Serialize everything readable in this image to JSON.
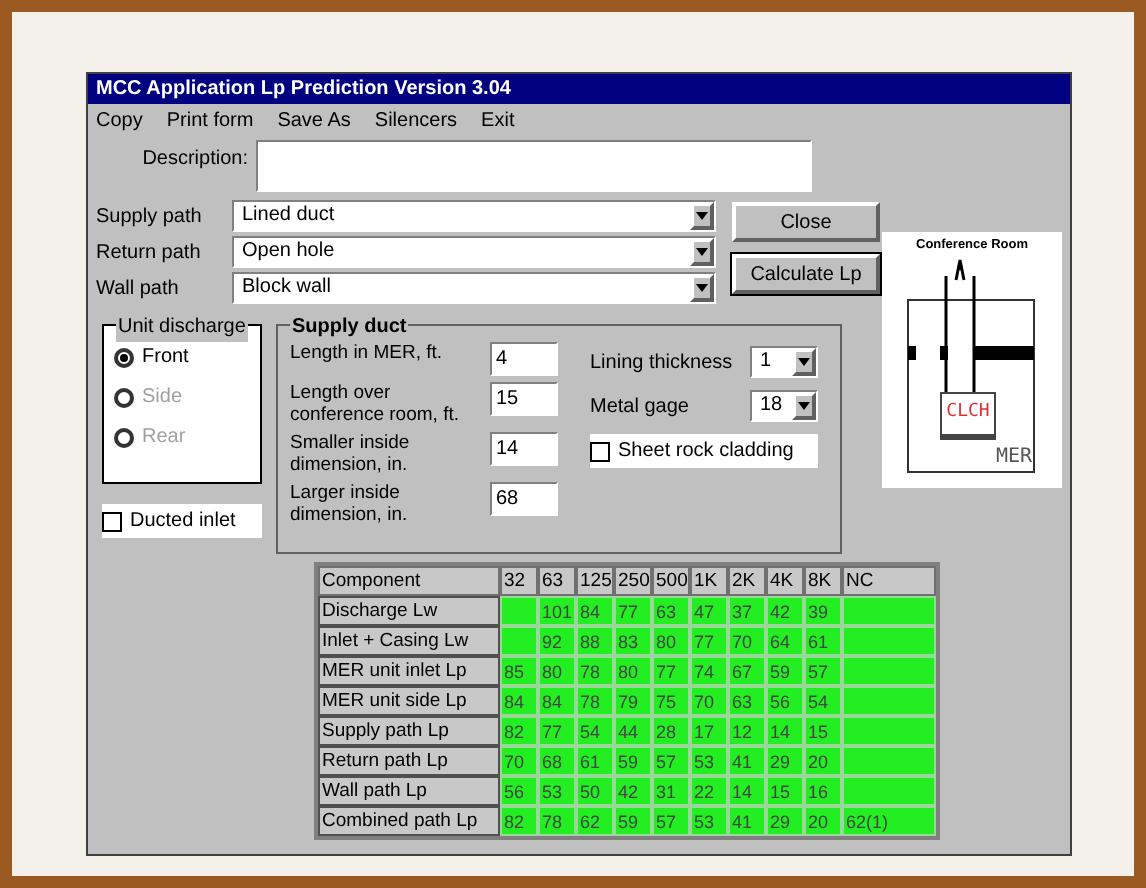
{
  "window": {
    "title": "MCC Application Lp Prediction Version 3.04"
  },
  "menu": [
    {
      "label": "Copy"
    },
    {
      "label": "Print form"
    },
    {
      "label": "Save As"
    },
    {
      "label": "Silencers"
    },
    {
      "label": "Exit"
    }
  ],
  "description": {
    "label": "Description:"
  },
  "paths": [
    {
      "label": "Supply path",
      "value": "Lined duct"
    },
    {
      "label": "Return path",
      "value": "Open hole"
    },
    {
      "label": "Wall path",
      "value": "Block wall"
    }
  ],
  "buttons": [
    {
      "label": "Close",
      "default": false
    },
    {
      "label": "Calculate Lp",
      "default": true
    }
  ],
  "unit_discharge": {
    "title": "Unit discharge",
    "options": [
      {
        "label": "Front",
        "selected": true,
        "disabled": false
      },
      {
        "label": "Side",
        "selected": false,
        "disabled": true
      },
      {
        "label": "Rear",
        "selected": false,
        "disabled": true
      }
    ]
  },
  "ducted_inlet": {
    "label": "Ducted inlet",
    "checked": false
  },
  "supply_duct": {
    "title": "Supply duct",
    "fields": [
      {
        "label": "Length in MER, ft.",
        "value": "4"
      },
      {
        "label": "Length over conference room, ft.",
        "value": "15"
      },
      {
        "label": "Smaller inside dimension, in.",
        "value": "14"
      },
      {
        "label": "Larger inside dimension, in.",
        "value": "68"
      }
    ],
    "lining_thickness": {
      "label": "Lining thickness",
      "value": "1"
    },
    "metal_gage": {
      "label": "Metal gage",
      "value": "18"
    },
    "sheet_rock": {
      "label": "Sheet rock cladding",
      "checked": false
    }
  },
  "diagram": {
    "title": "Conference Room",
    "unit_label": "CLCH",
    "room_label": "MER"
  },
  "table": {
    "columns": [
      "Component",
      "32",
      "63",
      "125",
      "250",
      "500",
      "1K",
      "2K",
      "4K",
      "8K",
      "NC"
    ],
    "rows": [
      [
        "Discharge Lw",
        null,
        "101",
        "84",
        "77",
        "63",
        "47",
        "37",
        "42",
        "39",
        null
      ],
      [
        "Inlet + Casing Lw",
        null,
        "92",
        "88",
        "83",
        "80",
        "77",
        "70",
        "64",
        "61",
        null
      ],
      [
        "MER unit inlet Lp",
        "85",
        "80",
        "78",
        "80",
        "77",
        "74",
        "67",
        "59",
        "57",
        null
      ],
      [
        "MER unit side Lp",
        "84",
        "84",
        "78",
        "79",
        "75",
        "70",
        "63",
        "56",
        "54",
        null
      ],
      [
        "Supply path Lp",
        "82",
        "77",
        "54",
        "44",
        "28",
        "17",
        "12",
        "14",
        "15",
        null
      ],
      [
        "Return path Lp",
        "70",
        "68",
        "61",
        "59",
        "57",
        "53",
        "41",
        "29",
        "20",
        null
      ],
      [
        "Wall path Lp",
        "56",
        "53",
        "50",
        "42",
        "31",
        "22",
        "14",
        "15",
        "16",
        null
      ],
      [
        "Combined path Lp",
        "82",
        "78",
        "62",
        "59",
        "57",
        "53",
        "41",
        "29",
        "20",
        "62(1)"
      ]
    ]
  }
}
